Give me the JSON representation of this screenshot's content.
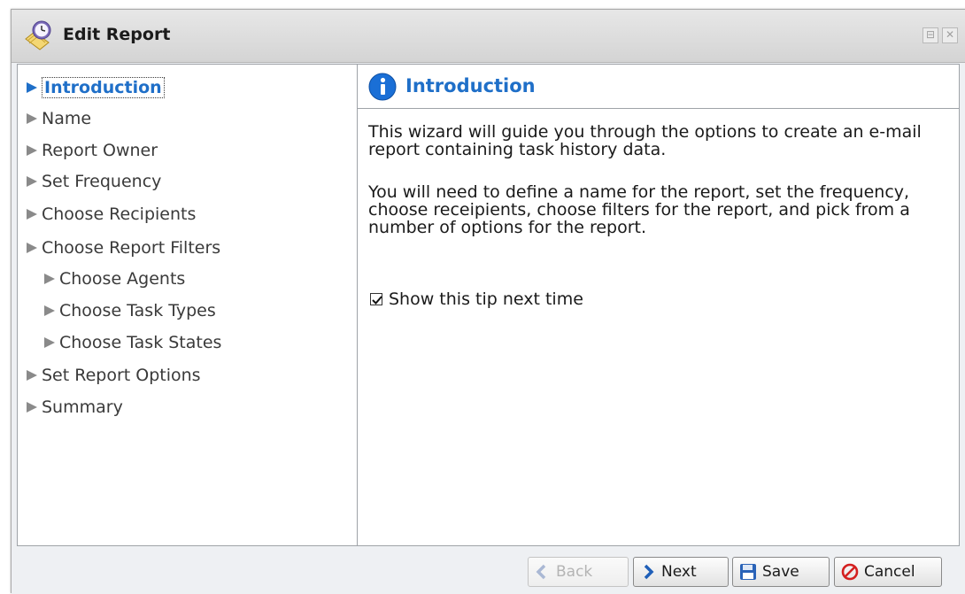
{
  "window": {
    "title": "Edit Report"
  },
  "nav": {
    "items": [
      {
        "label": "Introduction"
      },
      {
        "label": "Name"
      },
      {
        "label": "Report Owner"
      },
      {
        "label": "Set Frequency"
      },
      {
        "label": "Choose Recipients"
      },
      {
        "label": "Choose Report Filters"
      },
      {
        "label": "Choose Agents"
      },
      {
        "label": "Choose Task Types"
      },
      {
        "label": "Choose Task States"
      },
      {
        "label": "Set Report Options"
      },
      {
        "label": "Summary"
      }
    ]
  },
  "content": {
    "title": "Introduction",
    "para1": "This wizard will guide you through the options to create an e-mail report containing task history data.",
    "para2": "You will need to define a name for the report, set the frequency, choose receipients, choose filters for the report, and pick from a number of options for the report.",
    "tip_label": "Show this tip next time",
    "tip_checked": true
  },
  "footer": {
    "back_label": "Back",
    "next_label": "Next",
    "save_label": "Save",
    "cancel_label": "Cancel"
  },
  "colors": {
    "accent": "#1f6fc8",
    "cancel_red": "#d42020",
    "nav_arrow_active": "#1f6fc8",
    "nav_arrow": "#8a8a8a"
  },
  "icons": {
    "title": "report-clock-icon",
    "info": "info-icon",
    "back": "left-arrow-icon",
    "next": "right-arrow-icon",
    "save": "floppy-disk-icon",
    "cancel": "cancel-circle-icon"
  }
}
